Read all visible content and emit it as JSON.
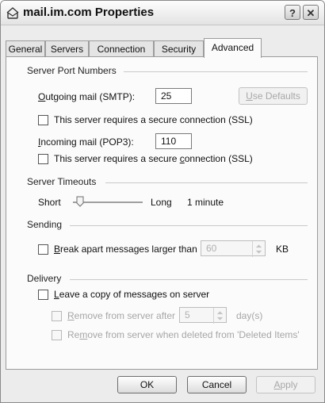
{
  "title": "mail.im.com Properties",
  "help_btn": "?",
  "close_btn": "✕",
  "tabs": [
    "General",
    "Servers",
    "Connection",
    "Security",
    "Advanced"
  ],
  "groups": {
    "ports": "Server Port Numbers",
    "timeouts": "Server Timeouts",
    "sending": "Sending",
    "delivery": "Delivery"
  },
  "ports": {
    "smtp_label": "utgoing mail (SMTP):",
    "smtp_label_ul": "O",
    "smtp_value": "25",
    "use_defaults": "se Defaults",
    "use_defaults_ul": "U",
    "ssl1": "This server requires a secure connection (SSL)",
    "pop3_label": "ncoming mail (POP3):",
    "pop3_label_ul": "I",
    "pop3_value": "110",
    "ssl2_pre": "This server requires a secure ",
    "ssl2_ul": "c",
    "ssl2_post": "onnection (SSL)"
  },
  "timeouts": {
    "short": "Short",
    "long": "Long",
    "value_text": "1 minute",
    "level": 0.05
  },
  "sending": {
    "break_ul": "B",
    "break_label": "reak apart messages larger than",
    "size_value": "60",
    "unit": "KB"
  },
  "delivery": {
    "leave_copy_ul": "L",
    "leave_copy": "eave a copy of messages on server",
    "remove_after_ul": "R",
    "remove_after": "emove from server after",
    "days_value": "5",
    "days_unit": "day(s)",
    "remove_deleted_pre": "Re",
    "remove_deleted_ul": "m",
    "remove_deleted_post": "ove from server when deleted from 'Deleted Items'"
  },
  "buttons": {
    "ok": "OK",
    "cancel": "Cancel",
    "apply_ul": "A",
    "apply": "pply"
  }
}
